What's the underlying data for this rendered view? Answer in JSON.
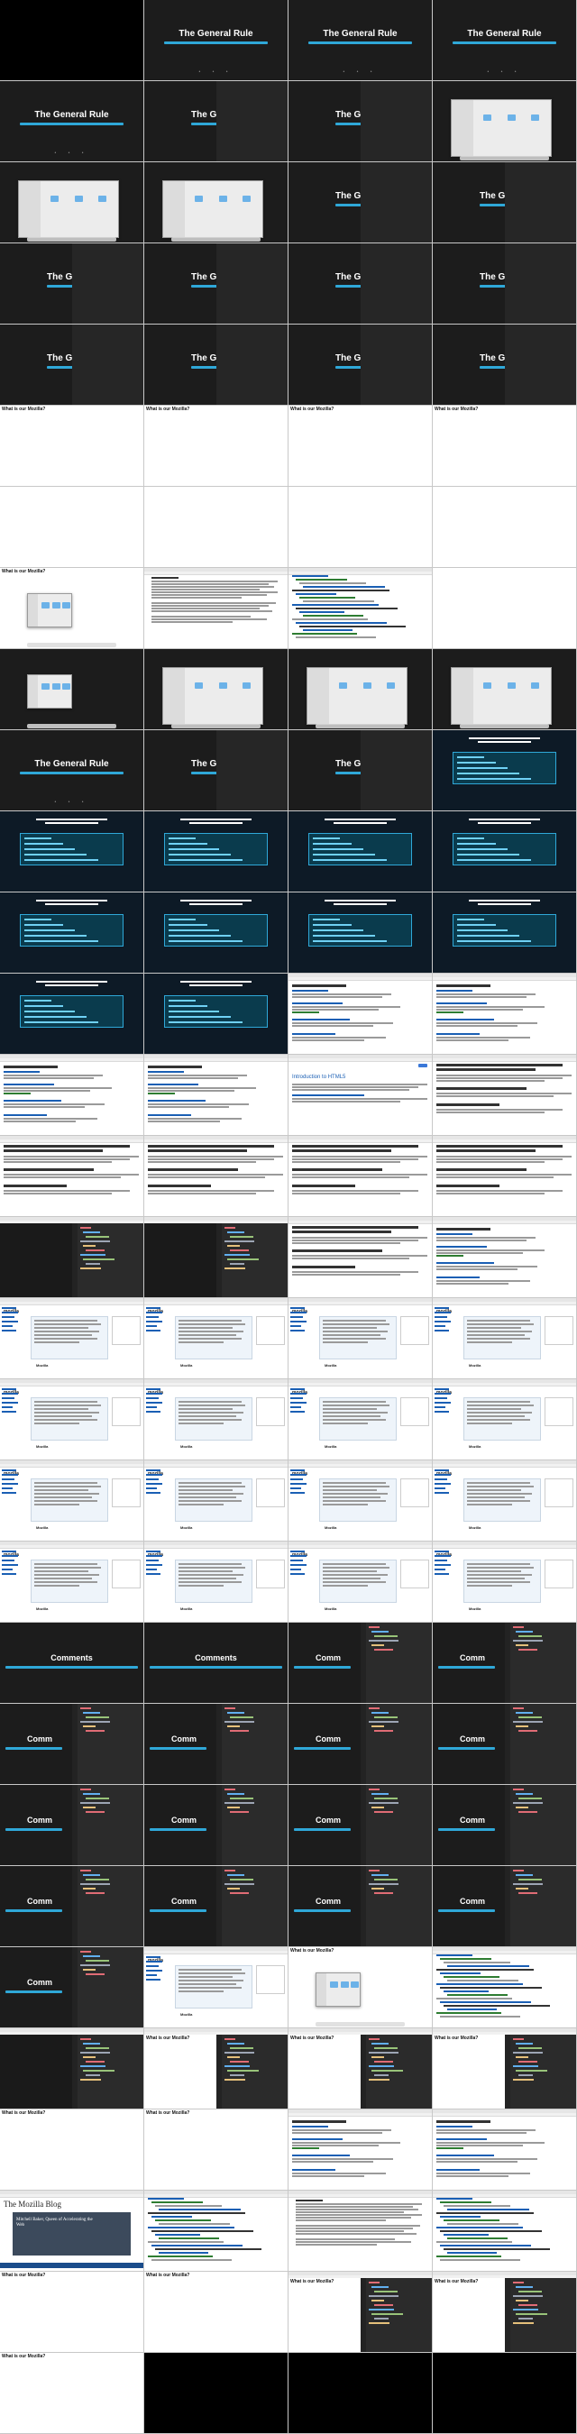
{
  "slides": {
    "general_rule_title": "The General Rule",
    "comments_title": "Comments",
    "comments_partial_title": "Comm"
  },
  "captions": {
    "question": "What is our Mozilla?"
  },
  "blog": {
    "title": "The Mozilla Blog",
    "hero_text": "Mitchell Baker, Queen of Accelerating the Web"
  },
  "browser": {
    "mdn_heading": "Introduction to HTML5",
    "mdn_logo": "mozilla",
    "mdn_page_label": "Mozilla"
  },
  "colors": {
    "slide_bg": "#1c1c1c",
    "slide_accent": "#2fa8d8",
    "editor_bg": "#2b2b2b",
    "link_blue": "#1a5fb4"
  },
  "icons": [
    "folder-icon",
    "dock-icon"
  ]
}
